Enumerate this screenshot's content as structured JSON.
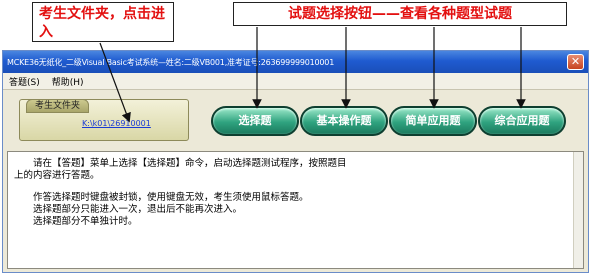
{
  "annotations": {
    "folder_callout": "考生文件夹，点击进入",
    "buttons_callout": "试题选择按钮——查看各种题型试题"
  },
  "window": {
    "title": "MCKE36无纸化_二级Visual Basic考试系统—姓名:二级VB001,准考证号:263699999010001",
    "close_glyph": "✕"
  },
  "menu": {
    "items": [
      "答题(S)",
      "帮助(H)"
    ]
  },
  "folder": {
    "label": "考生文件夹",
    "path": "K:\\k01\\26910001"
  },
  "question_buttons": [
    "选择题",
    "基本操作题",
    "简单应用题",
    "综合应用题"
  ],
  "content": {
    "lines": [
      "　　请在【答题】菜单上选择【选择题】命令，启动选择题测试程序，按照题目",
      "上的内容进行答题。",
      "　　作答选择题时键盘被封锁，使用键盘无效，考生须使用鼠标答题。",
      "　　选择题部分只能进入一次，退出后不能再次进入。",
      "　　选择题部分不单独计时。"
    ]
  },
  "colors": {
    "callout_text": "#e31010",
    "title_bar": "#1f5bd0",
    "button_green": "#2fa37f"
  }
}
